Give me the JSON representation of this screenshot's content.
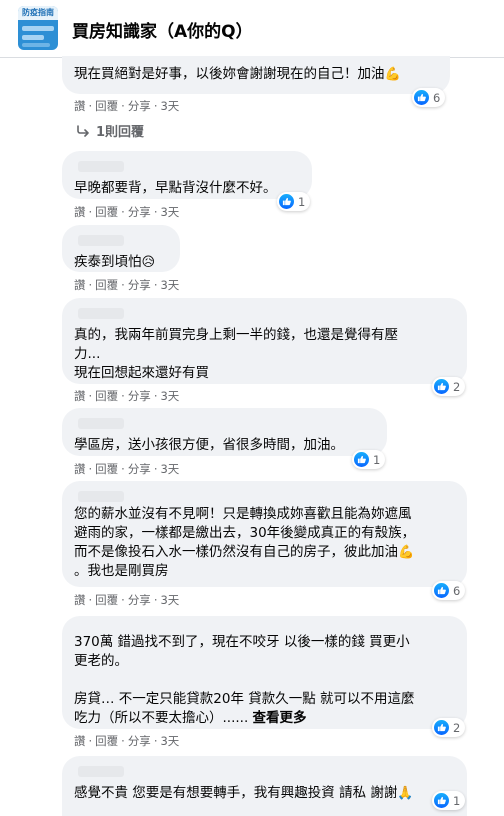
{
  "header": {
    "group_avatar_text": "防疫指南",
    "title": "買房知識家（A你的Q）"
  },
  "actions": {
    "like": "讚",
    "reply": "回覆",
    "share": "分享",
    "dot": "·"
  },
  "replies_link": "1則回覆",
  "comments": [
    {
      "text": "現在買絕對是好事，以後妳會謝謝現在的自己！加油",
      "emoji": "💪",
      "time": "3天",
      "reactions": "6"
    },
    {
      "text": "早晚都要背，早點背沒什麼不好。",
      "time": "3天",
      "reactions": "1"
    },
    {
      "text": "疾泰到頃怕",
      "emoji": "😥",
      "time": "3天",
      "reactions": ""
    },
    {
      "text": "真的，我兩年前買完身上剩一半的錢，也還是覺得有壓\n力...\n現在回想起來還好有買",
      "time": "3天",
      "reactions": "2"
    },
    {
      "text": "學區房，送小孩很方便，省很多時間，加油。",
      "time": "3天",
      "reactions": "1"
    },
    {
      "text": "您的薪水並沒有不見啊！只是轉換成妳喜歡且能為妳遮風\n避雨的家，一樣都是繳出去，30年後變成真正的有殼族，\n而不是像投石入水一樣仍然沒有自己的房子，彼此加油",
      "emoji": "💪",
      "text2": "。我也是剛買房",
      "time": "3天",
      "reactions": "6"
    },
    {
      "text": "370萬 錯過找不到了，現在不咬牙 以後一樣的錢 買更小\n更老的。\n\n房貸… 不一定只能貸款20年 貸款久一點 就可以不用這麼\n吃力（所以不要太擔心）......",
      "more": "查看更多",
      "time": "3天",
      "reactions": "2"
    },
    {
      "text": "感覺不貴 您要是有想要轉手，我有興趣投資 請私 謝謝",
      "emoji": "🙏",
      "time": "",
      "reactions": "1"
    }
  ]
}
